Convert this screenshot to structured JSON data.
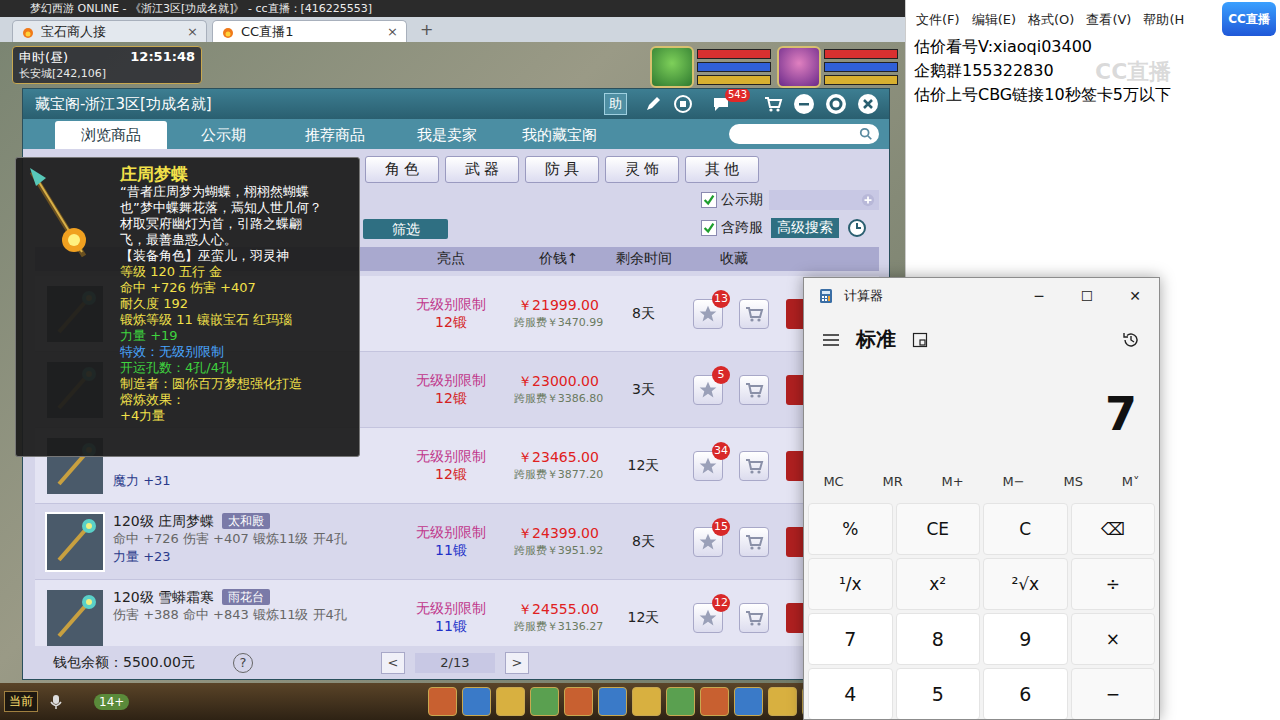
{
  "app_title": "梦幻西游 ONLINE - 《浙江3区[功成名就]》 - cc直播：[416225553]",
  "browser_tabs": [
    {
      "label": "宝石商人接",
      "selected": false
    },
    {
      "label": "CC直播1",
      "selected": true
    }
  ],
  "tab_close": "×",
  "new_tab": "+",
  "hud": {
    "period": "申时(昼)",
    "clock": "12:51:48",
    "location": "长安城[242,106]"
  },
  "panel": {
    "title": "藏宝阁-浙江3区[功成名就]",
    "help": "助",
    "messages": "543",
    "tabs": [
      {
        "label": "浏览商品",
        "selected": true
      },
      {
        "label": "公示期",
        "selected": false
      },
      {
        "label": "推荐商品",
        "selected": false
      },
      {
        "label": "我是卖家",
        "selected": false
      },
      {
        "label": "我的藏宝阁",
        "selected": false
      }
    ],
    "categories": [
      {
        "label": "角 色",
        "selected": false
      },
      {
        "label": "武 器",
        "selected": false
      },
      {
        "label": "防 具",
        "selected": false
      },
      {
        "label": "灵 饰",
        "selected": false
      },
      {
        "label": "其 他",
        "selected": false
      }
    ],
    "filter_button": "筛选",
    "filters": [
      {
        "label": "公示期",
        "checked": true
      },
      {
        "label": "含跨服",
        "checked": true
      }
    ],
    "advanced_search": "高级搜索",
    "columns": [
      "亮点",
      "价钱↑",
      "剩余时间",
      "收藏"
    ],
    "rows": [
      {
        "selected": false,
        "highlight": "无级别限制",
        "forge": "12锻",
        "forge_color": "#d42020",
        "price": "￥21999.00",
        "fee": "跨服费￥3470.99",
        "days": "8天",
        "favorites": "13"
      },
      {
        "selected": false,
        "highlight": "无级别限制",
        "forge": "12锻",
        "forge_color": "#d42020",
        "price": "￥23000.00",
        "fee": "跨服费￥3386.80",
        "days": "3天",
        "favorites": "5"
      },
      {
        "selected": false,
        "extra": "魔力 +31",
        "highlight": "无级别限制",
        "forge": "12锻",
        "forge_color": "#d42020",
        "price": "￥23465.00",
        "fee": "跨服费￥3877.20",
        "days": "12天",
        "favorites": "34"
      },
      {
        "selected": true,
        "name": "120级 庄周梦蝶",
        "server": "太和殿",
        "stats": "命中 +726 伤害 +407 锻炼11级 开4孔",
        "extra": "力量 +23",
        "highlight": "无级别限制",
        "forge": "11锻",
        "forge_color": "#2030c8",
        "price": "￥24399.00",
        "fee": "跨服费￥3951.92",
        "days": "8天",
        "favorites": "15"
      },
      {
        "selected": false,
        "name": "120级 雪蟒霜寒",
        "server": "雨花台",
        "stats": "伤害 +388 命中 +843 锻炼11级 开4孔",
        "highlight": "无级别限制",
        "forge": "11锻",
        "forge_color": "#2030c8",
        "price": "￥24555.00",
        "fee": "跨服费￥3136.27",
        "days": "12天",
        "favorites": "12"
      }
    ],
    "wallet": "钱包余额：5500.00元",
    "wallet_help": "?",
    "prev": "<",
    "page": "2/13",
    "next": ">"
  },
  "tooltip": {
    "title": "庄周梦蝶",
    "description": "“昔者庄周梦为蝴蝶，栩栩然蝴蝶也”梦中蝶舞花落，焉知人世几何？材取冥府幽灯为首，引路之蝶翩飞，最善蛊惑人心。",
    "lines": [
      {
        "text": "【装备角色】巫蛮儿，羽灵神",
        "color": "#ffffff"
      },
      {
        "text": "等级 120 五行 金",
        "color": "#f2e14a"
      },
      {
        "text": "命中 +726 伤害 +407",
        "color": "#f2e14a"
      },
      {
        "text": "耐久度 192",
        "color": "#f2e14a"
      },
      {
        "text": "锻炼等级 11 镶嵌宝石 红玛瑙",
        "color": "#f2e14a"
      },
      {
        "text": "力量 +19",
        "color": "#3fd43f"
      },
      {
        "text": "特效：无级别限制",
        "color": "#4aa6ff"
      },
      {
        "text": "开运孔数：4孔/4孔",
        "color": "#3fd43f"
      },
      {
        "text": "制造者：圆你百万梦想强化打造",
        "color": "#f2e14a"
      },
      {
        "text": "熔炼效果：",
        "color": "#f2e14a"
      },
      {
        "text": "+4力量",
        "color": "#f2e14a"
      }
    ]
  },
  "notepad": {
    "menu": [
      "文件(F)",
      "编辑(E)",
      "格式(O)",
      "查看(V)",
      "帮助(H"
    ],
    "lines": [
      "估价看号V:xiaoqi03400",
      "企鹅群155322830",
      "估价上号CBG链接10秒签卡5万以下"
    ]
  },
  "logo": "CC直播",
  "watermark": "CC直播",
  "calculator": {
    "title": "计算器",
    "controls": [
      "─",
      "☐",
      "✕"
    ],
    "mode": "标准",
    "display": "7",
    "memory": [
      "MC",
      "MR",
      "M+",
      "M−",
      "MS",
      "M˅"
    ],
    "keys": [
      {
        "label": "%",
        "kind": "function"
      },
      {
        "label": "CE",
        "kind": "function"
      },
      {
        "label": "C",
        "kind": "function"
      },
      {
        "label": "⌫",
        "kind": "function"
      },
      {
        "label": "¹/x",
        "kind": "function"
      },
      {
        "label": "x²",
        "kind": "function"
      },
      {
        "label": "²√x",
        "kind": "function"
      },
      {
        "label": "÷",
        "kind": "function"
      },
      {
        "label": "7",
        "kind": "digit"
      },
      {
        "label": "8",
        "kind": "digit"
      },
      {
        "label": "9",
        "kind": "digit"
      },
      {
        "label": "×",
        "kind": "function"
      },
      {
        "label": "4",
        "kind": "digit"
      },
      {
        "label": "5",
        "kind": "digit"
      },
      {
        "label": "6",
        "kind": "digit"
      },
      {
        "label": "−",
        "kind": "function"
      }
    ]
  },
  "toolbar": {
    "channel": "当前",
    "age": "14+"
  }
}
